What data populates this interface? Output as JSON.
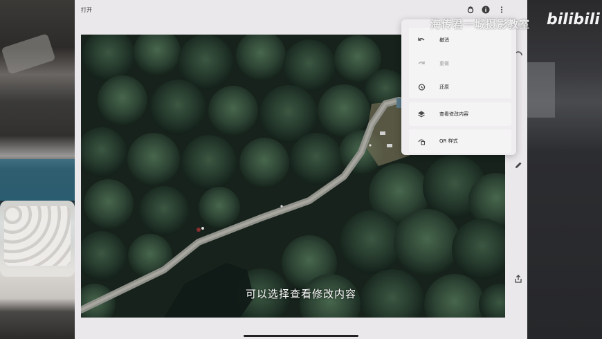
{
  "app": {
    "open_label": "打开"
  },
  "top_icons": {
    "looks_icon": "looks-icon",
    "info_icon": "info-icon",
    "more_icon": "more-vert-icon"
  },
  "menu": {
    "items": [
      {
        "label": "撤消",
        "icon": "undo-icon",
        "enabled": true
      },
      {
        "label": "重做",
        "icon": "redo-icon",
        "enabled": false
      },
      {
        "label": "还原",
        "icon": "restore-icon",
        "enabled": true
      },
      {
        "label": "查看修改内容",
        "icon": "layers-icon",
        "enabled": true
      },
      {
        "label": "QR 样式",
        "icon": "qr-style-icon",
        "enabled": true
      }
    ]
  },
  "subtitle": "可以选择查看修改内容",
  "watermark": {
    "channel": "海传君一城摄影教室",
    "logo": "bilibili"
  },
  "colors": {
    "app_bg": "#eae8ea",
    "menu_bg": "#f5f4f5",
    "forest": "#1e2a22"
  }
}
